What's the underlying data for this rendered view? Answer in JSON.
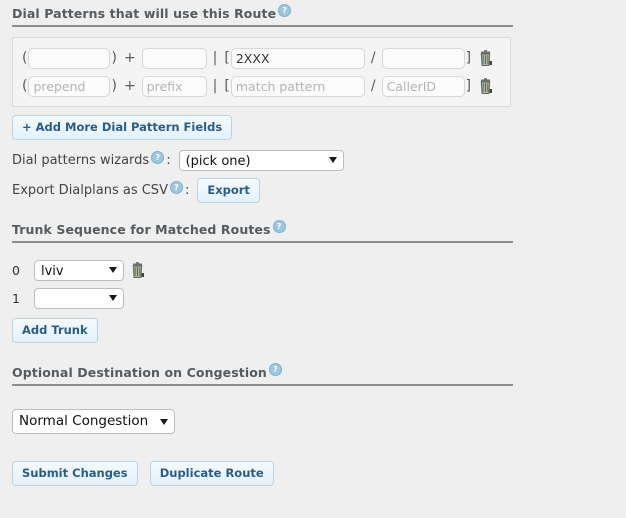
{
  "sections": {
    "dial_patterns": {
      "title": "Dial Patterns that will use this Route",
      "help_glyph": "?",
      "rows": [
        {
          "prepend_value": "",
          "prefix_value": "",
          "match_value": "2XXX",
          "callerid_value": "",
          "delete_label": "trash-icon"
        },
        {
          "prepend_value": "",
          "prefix_value": "",
          "match_value": "",
          "callerid_value": "",
          "delete_label": "trash-icon"
        }
      ],
      "placeholders": {
        "prepend": "prepend",
        "prefix": "prefix",
        "match": "match pattern",
        "callerid": "CallerID"
      },
      "separators": {
        "open_paren": "(",
        "close_paren": ")",
        "plus": "+",
        "pipe": "|",
        "open_bracket": "[",
        "slash": "/",
        "close_bracket": "]"
      },
      "add_more_button": "+ Add More Dial Pattern Fields",
      "wizards_label": "Dial patterns wizards",
      "wizards_selected": "(pick one)",
      "export_label": "Export Dialplans as CSV",
      "export_button": "Export",
      "colon": ":"
    },
    "trunk_sequence": {
      "title": "Trunk Sequence for Matched Routes",
      "rows": [
        {
          "index": "0",
          "selected": "lviv",
          "has_delete": true
        },
        {
          "index": "1",
          "selected": "",
          "has_delete": false
        }
      ],
      "add_trunk_button": "Add Trunk"
    },
    "congestion": {
      "title": "Optional Destination on Congestion",
      "selected": "Normal Congestion"
    }
  },
  "footer": {
    "submit_button": "Submit Changes",
    "duplicate_button": "Duplicate Route"
  },
  "colors": {
    "background": "#efefef",
    "heading_text": "#555b5f",
    "rule": "#8b8f92",
    "button_text": "#2a5d87",
    "button_border": "#b9d3e5",
    "help_icon": "#9ec6e0"
  }
}
